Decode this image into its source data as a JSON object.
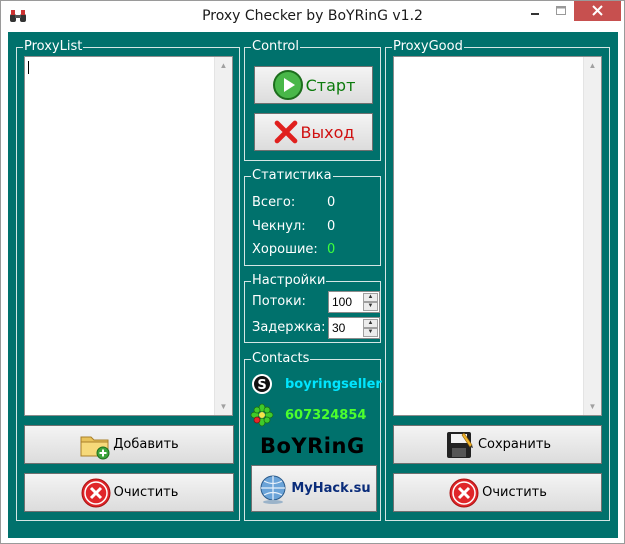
{
  "window": {
    "title": "Proxy Checker by BoYRinG v1.2",
    "accent": "#00716c",
    "close_color": "#c7504f"
  },
  "proxy_list": {
    "label": "ProxyList",
    "value": ""
  },
  "proxy_good": {
    "label": "ProxyGood",
    "value": ""
  },
  "control": {
    "label": "Control",
    "start_label": "Старт",
    "exit_label": "Выход"
  },
  "stats": {
    "label": "Статистика",
    "total_label": "Всего:",
    "total_value": "0",
    "checked_label": "Чекнул:",
    "checked_value": "0",
    "good_label": "Хорошие:",
    "good_value": "0"
  },
  "settings": {
    "label": "Настройки",
    "threads_label": "Потоки:",
    "threads_value": "100",
    "delay_label": "Задержка:",
    "delay_value": "30"
  },
  "contacts": {
    "label": "Contacts",
    "skype": "boyringseller",
    "icq": "607324854",
    "brand": "BoYRinG",
    "site_label": "MyHack.su"
  },
  "left_buttons": {
    "add_label": "Добавить",
    "clear_label": "Очистить"
  },
  "right_buttons": {
    "save_label": "Сохранить",
    "clear_label": "Очистить"
  }
}
